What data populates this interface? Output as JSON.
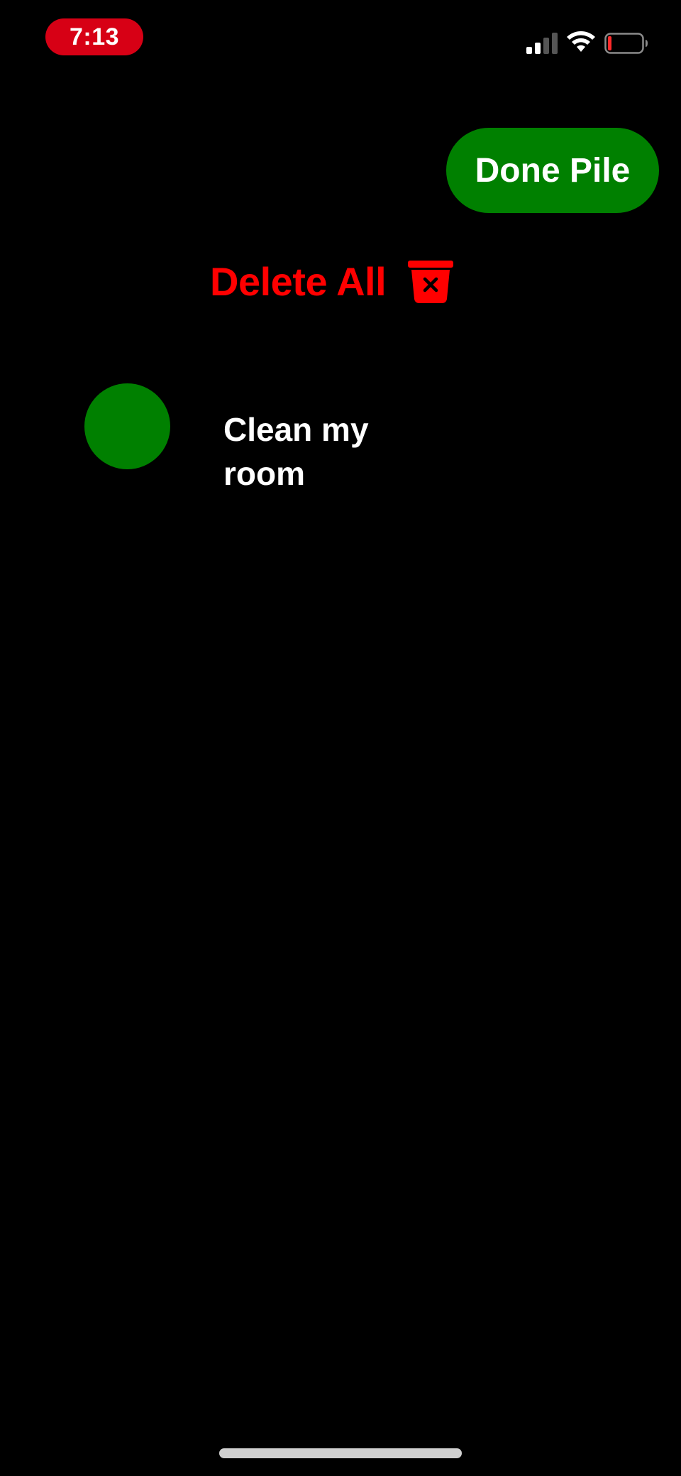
{
  "status_bar": {
    "time": "7:13",
    "time_pill_color": "#d70015",
    "icons": [
      "cellular-signal-icon",
      "wifi-icon",
      "battery-low-icon"
    ]
  },
  "header": {
    "done_pile_label": "Done Pile",
    "done_pile_color": "#008000"
  },
  "actions": {
    "delete_all_label": "Delete All",
    "delete_all_color": "#ff0000",
    "delete_icon": "trash-icon"
  },
  "tasks": [
    {
      "text": "Clean my room",
      "status_color": "#008000"
    }
  ]
}
